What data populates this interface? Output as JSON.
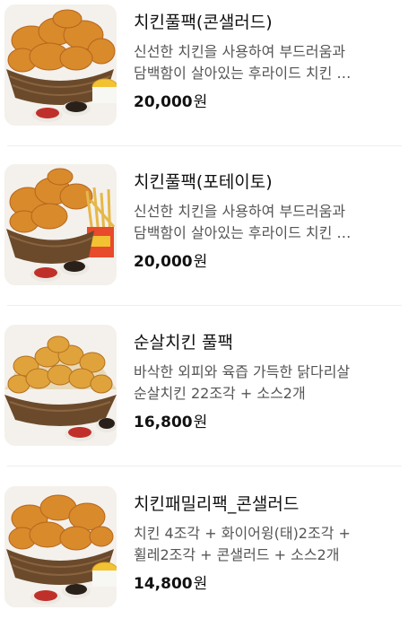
{
  "items": [
    {
      "title": "치킨풀팩(콘샐러드)",
      "desc_line1": "신선한 치킨을 사용하여 부드러움과",
      "desc_line2": "담백함이 살아있는 후라이드 치킨 …",
      "price": "20,000",
      "currency": "원",
      "side": "coleslaw"
    },
    {
      "title": "치킨풀팩(포테이토)",
      "desc_line1": "신선한 치킨을 사용하여 부드러움과",
      "desc_line2": "담백함이 살아있는 후라이드 치킨 …",
      "price": "20,000",
      "currency": "원",
      "side": "fries"
    },
    {
      "title": "순살치킨 풀팩",
      "desc_line1": "바삭한 외피와 육즙 가득한 닭다리살",
      "desc_line2": "순살치킨 22조각 + 소스2개",
      "price": "16,800",
      "currency": "원",
      "side": "none"
    },
    {
      "title": "치킨패밀리팩_콘샐러드",
      "desc_line1": "치킨 4조각 + 화이어윙(태)2조각 +",
      "desc_line2": "휠레2조각 + 콘샐러드 + 소스2개",
      "price": "14,800",
      "currency": "원",
      "side": "coleslaw"
    }
  ],
  "colors": {
    "chicken": "#d98a2b",
    "chicken_dark": "#b5651d",
    "basket": "#6b4a2b",
    "ketchup": "#c0302a",
    "sauce_dark": "#2a201a",
    "coleslaw": "#f2c232"
  }
}
